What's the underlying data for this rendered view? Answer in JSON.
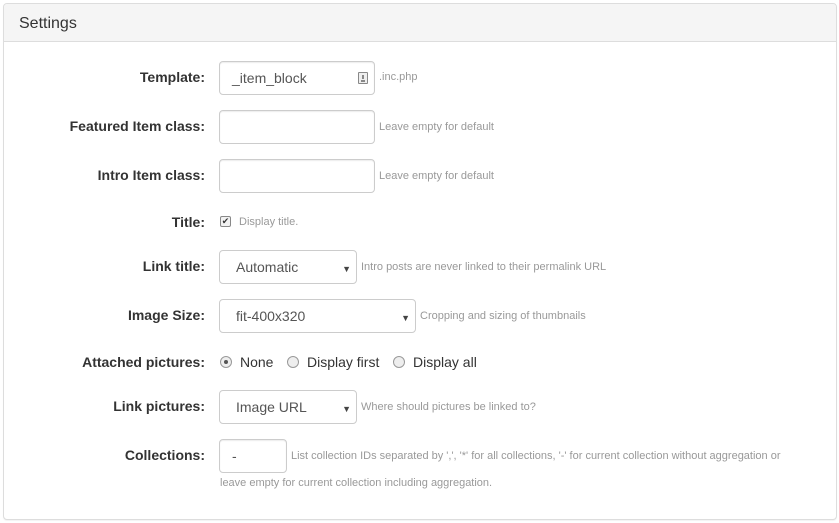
{
  "panel": {
    "title": "Settings"
  },
  "fields": {
    "template": {
      "label": "Template:",
      "value": "_item_block",
      "suffix": ".inc.php",
      "icon": "template-picker-icon"
    },
    "featured_item_class": {
      "label": "Featured Item class:",
      "value": "",
      "note": "Leave empty for default"
    },
    "intro_item_class": {
      "label": "Intro Item class:",
      "value": "",
      "note": "Leave empty for default"
    },
    "title": {
      "label": "Title:",
      "checked": true,
      "note": "Display title."
    },
    "link_title": {
      "label": "Link title:",
      "selected": "Automatic",
      "note": "Intro posts are never linked to their permalink URL"
    },
    "image_size": {
      "label": "Image Size:",
      "selected": "fit-400x320",
      "note": "Cropping and sizing of thumbnails"
    },
    "attached_pictures": {
      "label": "Attached pictures:",
      "options": [
        "None",
        "Display first",
        "Display all"
      ],
      "selected": "None"
    },
    "link_pictures": {
      "label": "Link pictures:",
      "selected": "Image URL",
      "note": "Where should pictures be linked to?"
    },
    "collections": {
      "label": "Collections:",
      "value": "-",
      "note_line1": "List collection IDs separated by ',', '*' for all collections, '-' for current collection without aggregation or",
      "note_line2": "leave empty for current collection including aggregation."
    }
  }
}
